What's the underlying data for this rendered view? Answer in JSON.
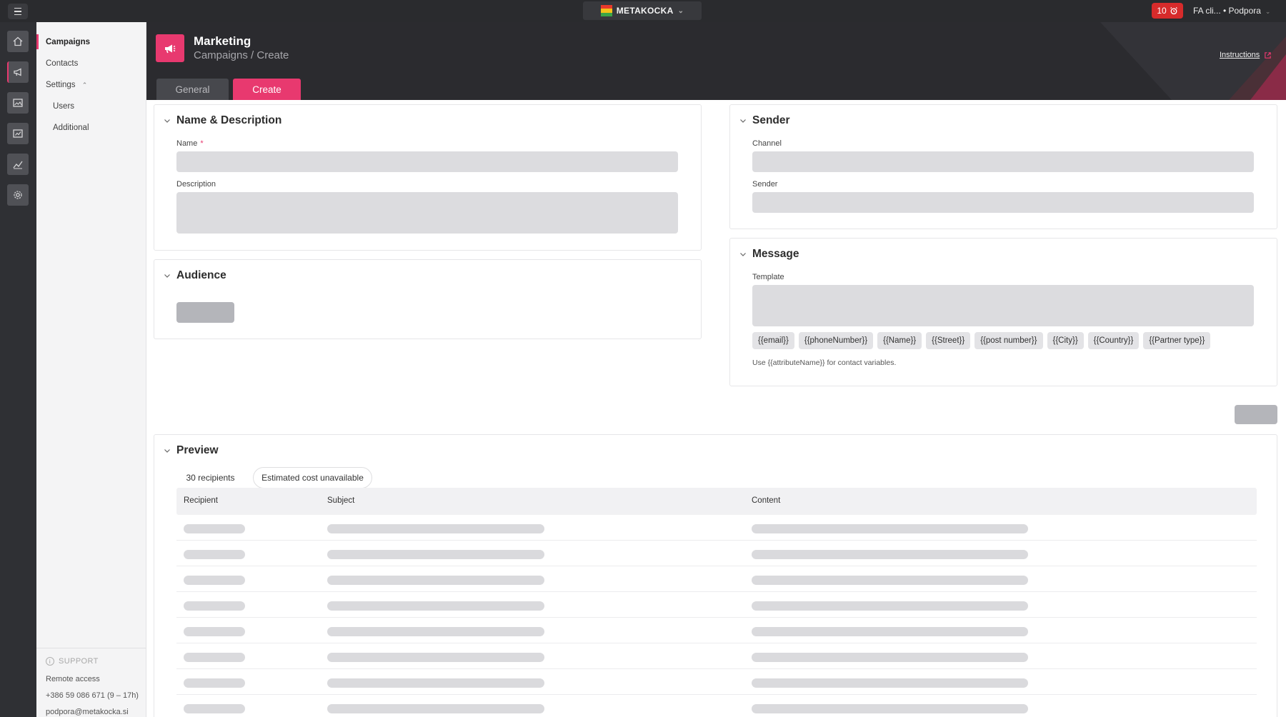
{
  "topbar": {
    "brand": "METAKOCKA",
    "notifications_count": "10",
    "account": "FA cli... • Podpora",
    "logo_colors": [
      "#e8392b",
      "#f2c21b",
      "#3aa547"
    ]
  },
  "rail": {
    "items": [
      "home-icon",
      "megaphone-icon",
      "image-icon",
      "chart-icon",
      "analytics-icon",
      "gear-icon"
    ]
  },
  "sidebar": {
    "campaigns": "Campaigns",
    "contacts": "Contacts",
    "settings": "Settings",
    "users": "Users",
    "additional": "Additional",
    "support_title": "SUPPORT",
    "remote_access": "Remote access",
    "phone": "+386 59 086 671 (9 – 17h)",
    "email": "podpora@metakocka.si"
  },
  "header": {
    "title": "Marketing",
    "breadcrumb": "Campaigns / Create",
    "instructions": "Instructions",
    "tabs": {
      "general": "General",
      "create": "Create"
    },
    "accent": "#e8396f"
  },
  "name_description": {
    "title": "Name & Description",
    "name_label": "Name",
    "required_mark": "*",
    "description_label": "Description"
  },
  "audience": {
    "title": "Audience"
  },
  "sender": {
    "title": "Sender",
    "channel_label": "Channel",
    "sender_label": "Sender"
  },
  "message": {
    "title": "Message",
    "template_label": "Template",
    "variables": [
      "{{email}}",
      "{{phoneNumber}}",
      "{{Name}}",
      "{{Street}}",
      "{{post number}}",
      "{{City}}",
      "{{Country}}",
      "{{Partner type}}"
    ],
    "hint": "Use {{attributeName}} for contact variables."
  },
  "preview": {
    "title": "Preview",
    "recipients": "30 recipients",
    "cost": "Estimated cost unavailable",
    "columns": {
      "recipient": "Recipient",
      "subject": "Subject",
      "content": "Content"
    },
    "skeleton_rows": 8
  }
}
